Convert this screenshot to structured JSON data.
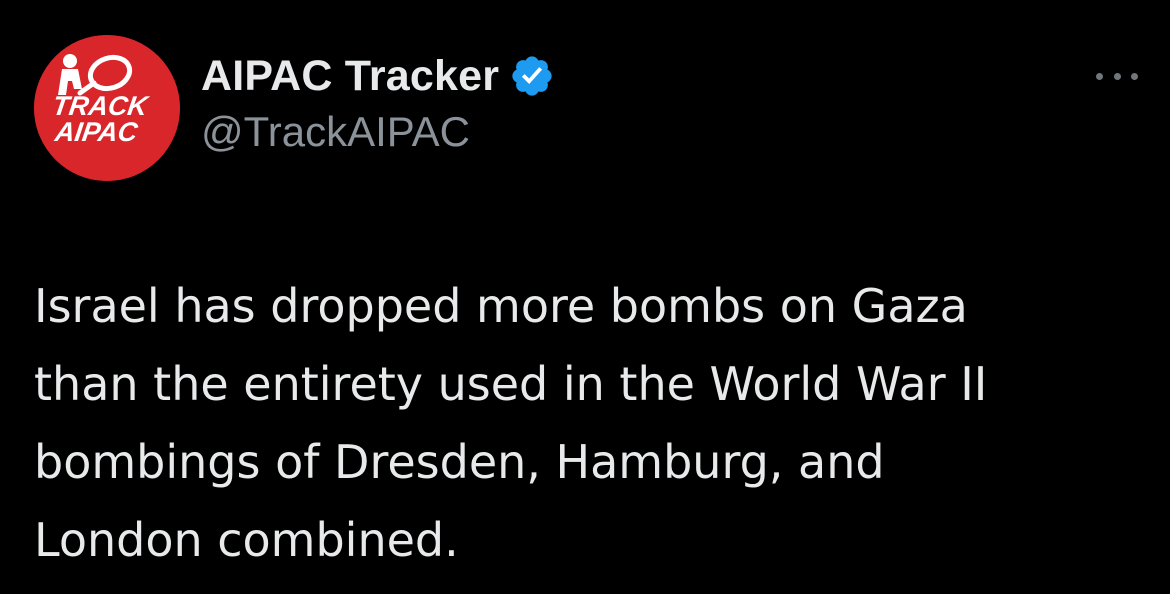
{
  "author": {
    "display_name": "AIPAC Tracker",
    "handle": "@TrackAIPAC",
    "verified": true,
    "avatar": {
      "line1": "TRACK",
      "line2": "AIPAC",
      "background": "#d8262b"
    }
  },
  "tweet": {
    "text": "Israel has dropped more bombs on Gaza\nthan the entirety used in the World War II\nbombings of Dresden, Hamburg, and\nLondon combined."
  },
  "icons": {
    "verified": "verified-badge-icon",
    "more": "more-options-icon"
  },
  "colors": {
    "background": "#000000",
    "text_primary": "#e7e9ea",
    "text_secondary": "#8b9299",
    "verified_blue": "#1d9bf0"
  }
}
